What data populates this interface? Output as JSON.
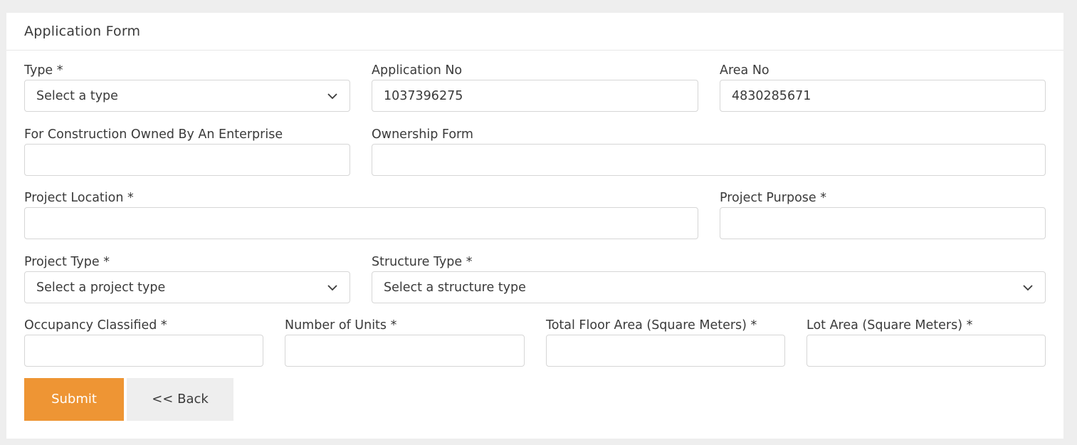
{
  "form": {
    "title": "Application Form",
    "type": {
      "label": "Type *",
      "value": "Select a type"
    },
    "application_no": {
      "label": "Application No",
      "value": "1037396275"
    },
    "area_no": {
      "label": "Area No",
      "value": "4830285671"
    },
    "construction_owned": {
      "label": "For Construction Owned By An Enterprise",
      "value": ""
    },
    "ownership_form": {
      "label": "Ownership Form",
      "value": ""
    },
    "project_location": {
      "label": "Project Location *",
      "value": ""
    },
    "project_purpose": {
      "label": "Project Purpose *",
      "value": ""
    },
    "project_type": {
      "label": "Project Type *",
      "value": "Select a project type"
    },
    "structure_type": {
      "label": "Structure Type *",
      "value": "Select a structure type"
    },
    "occupancy_classified": {
      "label": "Occupancy Classified *",
      "value": ""
    },
    "number_of_units": {
      "label": "Number of Units *",
      "value": ""
    },
    "total_floor_area": {
      "label": "Total Floor Area (Square Meters) *",
      "value": ""
    },
    "lot_area": {
      "label": "Lot Area (Square Meters) *",
      "value": ""
    }
  },
  "buttons": {
    "submit": "Submit",
    "back": "<< Back"
  },
  "icons": {
    "dropdown": "chevron-down-icon"
  },
  "colors": {
    "accent": "#ee9534",
    "back_button_bg": "#eeeeee",
    "input_border": "#d6d6d6"
  }
}
